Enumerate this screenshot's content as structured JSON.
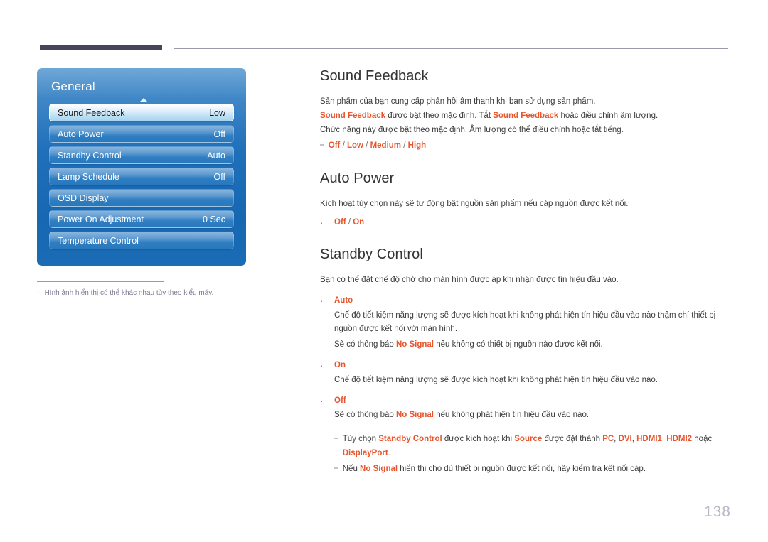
{
  "page": {
    "number": "138"
  },
  "osd": {
    "title": "General",
    "rows": [
      {
        "label": "Sound Feedback",
        "value": "Low",
        "selected": true
      },
      {
        "label": "Auto Power",
        "value": "Off",
        "selected": false
      },
      {
        "label": "Standby Control",
        "value": "Auto",
        "selected": false
      },
      {
        "label": "Lamp Schedule",
        "value": "Off",
        "selected": false
      },
      {
        "label": "OSD Display",
        "value": "",
        "selected": false
      },
      {
        "label": "Power On Adjustment",
        "value": "0 Sec",
        "selected": false
      },
      {
        "label": "Temperature Control",
        "value": "",
        "selected": false
      }
    ],
    "footnote_dash": "‒",
    "footnote": "Hình ảnh hiển thị có thể khác nhau tùy theo kiểu máy."
  },
  "sections": {
    "sound_feedback": {
      "title": "Sound Feedback",
      "line1": "Sản phẩm của bạn cung cấp phản hồi âm thanh khi bạn sử dụng sản phẩm.",
      "line2_a": "Sound Feedback",
      "line2_b": " được bật theo mặc định. Tắt ",
      "line2_c": "Sound Feedback",
      "line2_d": " hoặc điều chỉnh âm lượng.",
      "line3": "Chức năng này được bật theo mặc định. Âm lượng có thể điều chỉnh hoặc tắt tiếng.",
      "options_dash": "⎯",
      "options": [
        "Off",
        "Low",
        "Medium",
        "High"
      ],
      "options_sep": "/"
    },
    "auto_power": {
      "title": "Auto Power",
      "line1": "Kích hoạt tùy chọn này sẽ tự động bật nguồn sản phẩm nếu cáp nguồn được kết nối.",
      "bullet_dot": "·",
      "options": [
        "Off",
        "On"
      ],
      "options_sep": "/"
    },
    "standby_control": {
      "title": "Standby Control",
      "line1": "Bạn có thể đặt chế độ chờ cho màn hình được áp khi nhận được tín hiệu đầu vào.",
      "bullet_dot": "·",
      "items": [
        {
          "label": "Auto",
          "body1": "Chế độ tiết kiệm năng lượng sẽ được kích hoạt khi không phát hiện tín hiệu đầu vào nào thậm chí thiết bị nguồn được kết nối với màn hình.",
          "body2_pre": "Sẽ có thông báo ",
          "body2_hl": "No Signal",
          "body2_post": " nếu không có thiết bị nguồn nào được kết nối."
        },
        {
          "label": "On",
          "body1": "Chế độ tiết kiệm năng lượng sẽ được kích hoạt khi không phát hiện tín hiệu đầu vào nào.",
          "body2_pre": "",
          "body2_hl": "",
          "body2_post": ""
        },
        {
          "label": "Off",
          "body1": "",
          "body2_pre": "Sẽ có thông báo ",
          "body2_hl": "No Signal",
          "body2_post": " nếu không phát hiện tín hiệu đầu vào nào."
        }
      ],
      "notes": [
        {
          "dash": "⎯",
          "p1": "Tùy chọn ",
          "h1": "Standby Control",
          "p2": " được kích hoạt khi ",
          "h2": "Source",
          "p3": " được đặt thành ",
          "h3": "PC",
          "p4": ", ",
          "h4": "DVI",
          "p5": ", ",
          "h5": "HDMI1",
          "p6": ", ",
          "h6": "HDMI2",
          "p7": " hoặc ",
          "h7": "DisplayPort",
          "p8": "."
        },
        {
          "dash": "⎯",
          "p1": "Nếu ",
          "h1": "No Signal",
          "p2": " hiển thị cho dù thiết bị nguồn được kết nối, hãy kiểm tra kết nối cáp.",
          "h2": "",
          "p3": "",
          "h3": "",
          "p4": "",
          "h4": "",
          "p5": "",
          "h5": "",
          "p6": "",
          "h6": "",
          "p7": "",
          "h7": "",
          "p8": ""
        }
      ]
    }
  }
}
